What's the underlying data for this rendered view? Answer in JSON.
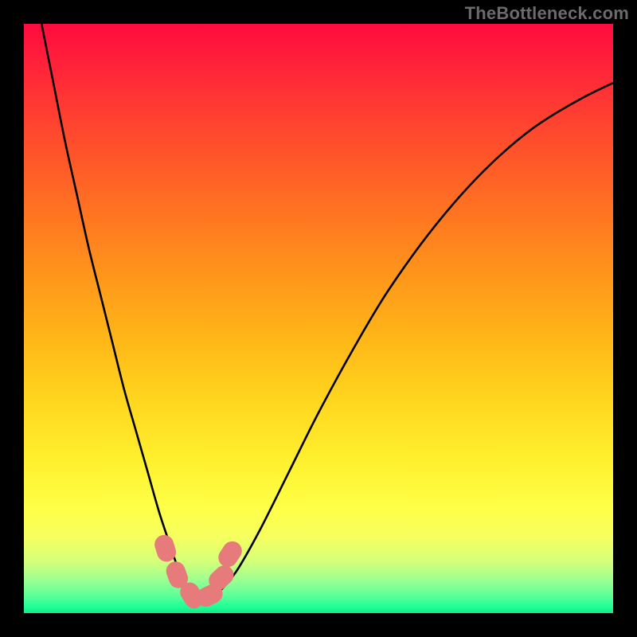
{
  "watermark": "TheBottleneck.com",
  "chart_data": {
    "type": "line",
    "title": "",
    "xlabel": "",
    "ylabel": "",
    "xlim": [
      0,
      100
    ],
    "ylim": [
      0,
      100
    ],
    "series": [
      {
        "name": "bottleneck-curve",
        "x": [
          3,
          5,
          7,
          9,
          11,
          13,
          15,
          17,
          19,
          21,
          23,
          25,
          26,
          27,
          28,
          29,
          30,
          31,
          33,
          36,
          40,
          45,
          50,
          56,
          62,
          70,
          78,
          86,
          94,
          100
        ],
        "y": [
          100,
          90,
          80,
          71,
          62,
          54,
          46,
          38,
          31,
          24,
          17,
          11,
          8,
          5.5,
          3.5,
          2.3,
          2,
          2.3,
          3.5,
          7,
          14,
          24,
          34,
          45,
          55,
          66,
          75,
          82,
          87,
          90
        ]
      }
    ],
    "markers": [
      {
        "name": "marker-left-upper",
        "x": 24.0,
        "y": 11.0
      },
      {
        "name": "marker-left-lower",
        "x": 26.0,
        "y": 6.5
      },
      {
        "name": "marker-bottom-left",
        "x": 28.5,
        "y": 3.0
      },
      {
        "name": "marker-bottom-right",
        "x": 31.5,
        "y": 3.0
      },
      {
        "name": "marker-right-lower",
        "x": 33.5,
        "y": 6.0
      },
      {
        "name": "marker-right-upper",
        "x": 35.0,
        "y": 10.0
      }
    ],
    "colors": {
      "curve": "#000000",
      "marker": "#e77a7a",
      "frame": "#000000"
    }
  }
}
